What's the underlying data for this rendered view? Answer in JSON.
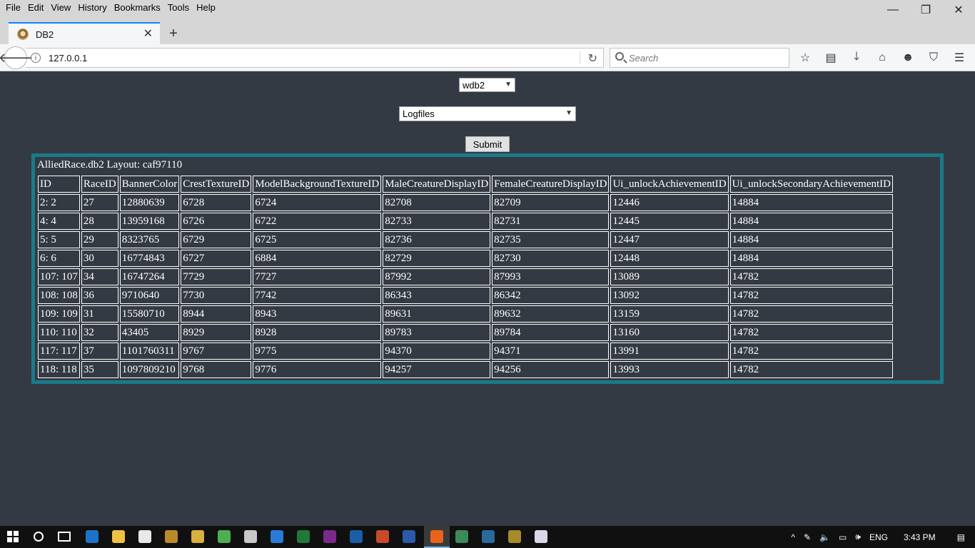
{
  "menu": [
    "File",
    "Edit",
    "View",
    "History",
    "Bookmarks",
    "Tools",
    "Help"
  ],
  "window_controls": {
    "minimize": "—",
    "maximize": "❐",
    "close": "✕"
  },
  "tab": {
    "title": "DB2",
    "close": "✕",
    "new_tab": "+"
  },
  "navbar": {
    "url": "127.0.0.1",
    "search_placeholder": "Search",
    "icons": [
      "bookmark-star-icon",
      "reading-list-icon",
      "download-icon",
      "home-icon",
      "smiley-icon",
      "pocket-icon",
      "hamburger-menu-icon"
    ]
  },
  "form": {
    "db_select": "wdb2",
    "file_select": "Logfiles",
    "submit_label": "Submit"
  },
  "table": {
    "caption": "AlliedRace.db2 Layout: caf97110",
    "columns": [
      "ID",
      "RaceID",
      "BannerColor",
      "CrestTextureID",
      "ModelBackgroundTextureID",
      "MaleCreatureDisplayID",
      "FemaleCreatureDisplayID",
      "Ui_unlockAchievementID",
      "Ui_unlockSecondaryAchievementID"
    ],
    "rows": [
      [
        "2: 2",
        "27",
        "12880639",
        "6728",
        "6724",
        "82708",
        "82709",
        "12446",
        "14884"
      ],
      [
        "4: 4",
        "28",
        "13959168",
        "6726",
        "6722",
        "82733",
        "82731",
        "12445",
        "14884"
      ],
      [
        "5: 5",
        "29",
        "8323765",
        "6729",
        "6725",
        "82736",
        "82735",
        "12447",
        "14884"
      ],
      [
        "6: 6",
        "30",
        "16774843",
        "6727",
        "6884",
        "82729",
        "82730",
        "12448",
        "14884"
      ],
      [
        "107: 107",
        "34",
        "16747264",
        "7729",
        "7727",
        "87992",
        "87993",
        "13089",
        "14782"
      ],
      [
        "108: 108",
        "36",
        "9710640",
        "7730",
        "7742",
        "86343",
        "86342",
        "13092",
        "14782"
      ],
      [
        "109: 109",
        "31",
        "15580710",
        "8944",
        "8943",
        "89631",
        "89632",
        "13159",
        "14782"
      ],
      [
        "110: 110",
        "32",
        "43405",
        "8929",
        "8928",
        "89783",
        "89784",
        "13160",
        "14782"
      ],
      [
        "117: 117",
        "37",
        "1101760311",
        "9767",
        "9775",
        "94370",
        "94371",
        "13991",
        "14782"
      ],
      [
        "118: 118",
        "35",
        "1097809210",
        "9768",
        "9776",
        "94257",
        "94256",
        "13993",
        "14782"
      ]
    ]
  },
  "taskbar": {
    "apps": [
      {
        "name": "edge-app",
        "color": "#1e73c8"
      },
      {
        "name": "file-explorer-app",
        "color": "#f0c040"
      },
      {
        "name": "store-app",
        "color": "#e8e8e8"
      },
      {
        "name": "wow-app",
        "color": "#b88a2a"
      },
      {
        "name": "hearthstone-app",
        "color": "#d8b040"
      },
      {
        "name": "chrome-like-app",
        "color": "#4caf50"
      },
      {
        "name": "paint-app",
        "color": "#c8c8c8"
      },
      {
        "name": "search-app",
        "color": "#2a7ad8"
      },
      {
        "name": "excel-app",
        "color": "#1f7a3a"
      },
      {
        "name": "onenote-app",
        "color": "#7a2a8a"
      },
      {
        "name": "outlook-app",
        "color": "#1a5ea8"
      },
      {
        "name": "powerpoint-app",
        "color": "#c84a28"
      },
      {
        "name": "word-app",
        "color": "#2a5aa8"
      },
      {
        "name": "firefox-app",
        "color": "#e8641a"
      },
      {
        "name": "triangle-app",
        "color": "#3a8a5a"
      },
      {
        "name": "blue-app",
        "color": "#2a6a9a"
      },
      {
        "name": "wow-app-2",
        "color": "#a88a2a"
      },
      {
        "name": "notepad-app",
        "color": "#d8d8e8"
      }
    ],
    "lang": "ENG",
    "time": "3:43 PM"
  },
  "colors": {
    "panel_border": "#1a7a8a",
    "page_bg": "#343a43"
  }
}
